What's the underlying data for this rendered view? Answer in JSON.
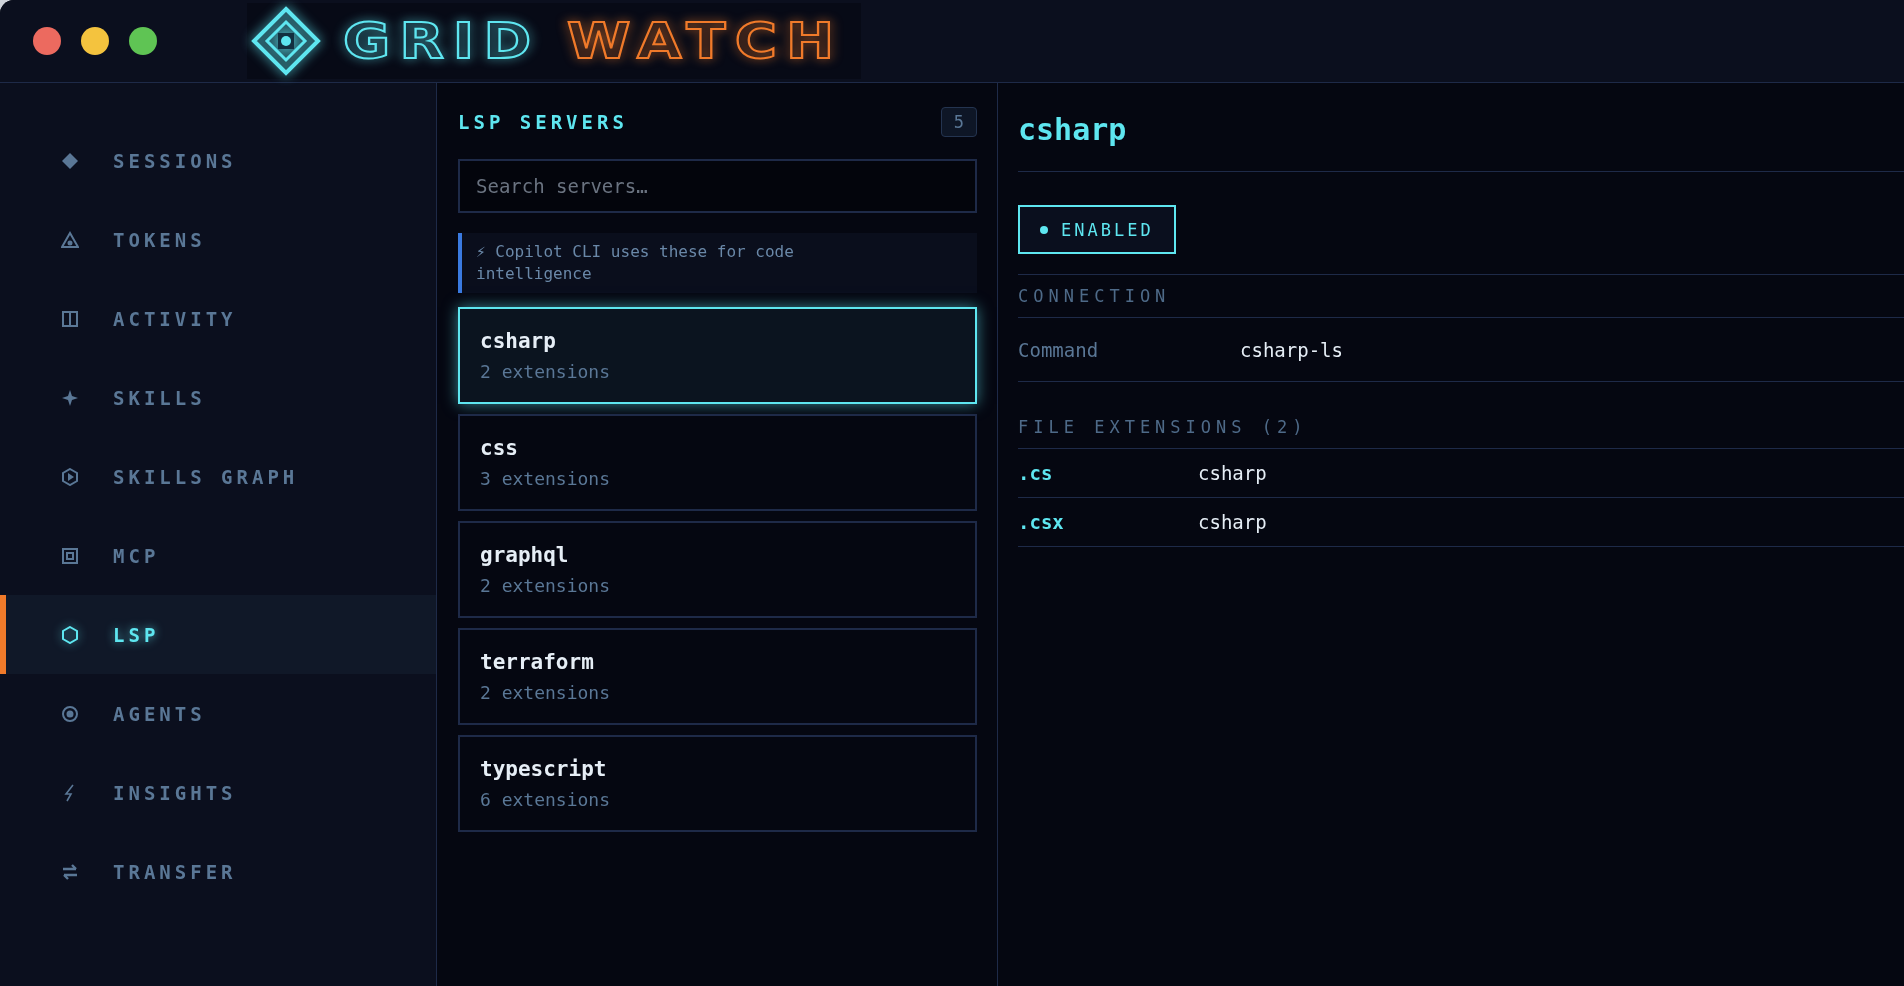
{
  "logo": {
    "first_word": "GRID",
    "second_word": "WATCH"
  },
  "sidebar": {
    "items": [
      {
        "label": "SESSIONS",
        "selected": false
      },
      {
        "label": "TOKENS",
        "selected": false
      },
      {
        "label": "ACTIVITY",
        "selected": false
      },
      {
        "label": "SKILLS",
        "selected": false
      },
      {
        "label": "SKILLS GRAPH",
        "selected": false
      },
      {
        "label": "MCP",
        "selected": false
      },
      {
        "label": "LSP",
        "selected": true
      },
      {
        "label": "AGENTS",
        "selected": false
      },
      {
        "label": "INSIGHTS",
        "selected": false
      },
      {
        "label": "TRANSFER",
        "selected": false
      }
    ]
  },
  "servers_panel": {
    "title": "LSP SERVERS",
    "count": "5",
    "search": {
      "placeholder": "Search servers…"
    },
    "hint": "⚡ Copilot CLI uses these for code intelligence",
    "servers": [
      {
        "name": "csharp",
        "extensions": "2 extensions",
        "selected": true
      },
      {
        "name": "css",
        "extensions": "3 extensions",
        "selected": false
      },
      {
        "name": "graphql",
        "extensions": "2 extensions",
        "selected": false
      },
      {
        "name": "terraform",
        "extensions": "2 extensions",
        "selected": false
      },
      {
        "name": "typescript",
        "extensions": "6 extensions",
        "selected": false
      }
    ]
  },
  "detail": {
    "title": "csharp",
    "status": {
      "label": "ENABLED",
      "enabled": true
    },
    "connection": {
      "heading": "CONNECTION",
      "rows": [
        {
          "label": "Command",
          "value": "csharp-ls"
        }
      ]
    },
    "file_extensions": {
      "heading": "FILE EXTENSIONS (2)",
      "rows": [
        {
          "extension": ".cs",
          "language": "csharp"
        },
        {
          "extension": ".csx",
          "language": "csharp"
        }
      ]
    }
  }
}
